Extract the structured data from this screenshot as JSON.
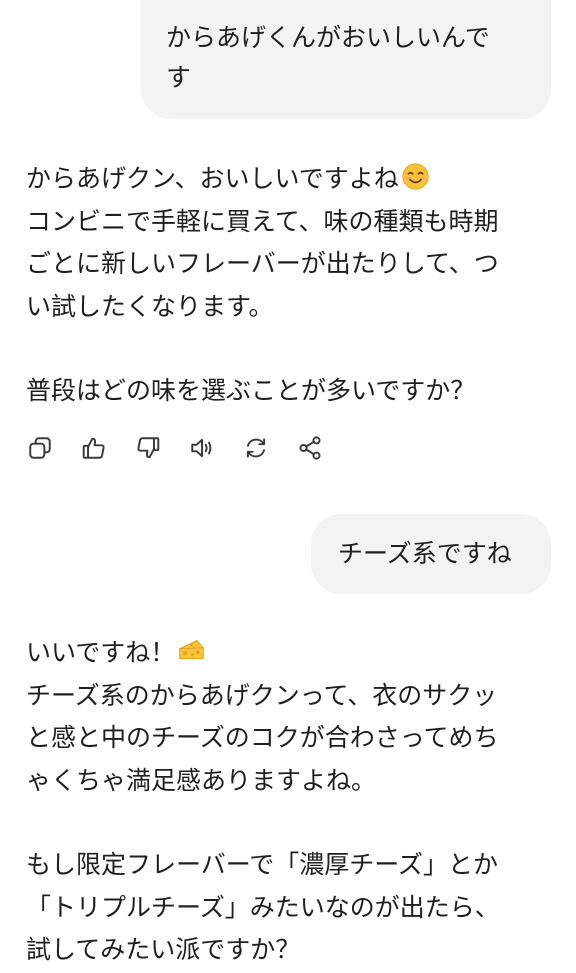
{
  "conversation": {
    "user_message_1": "からあげくんがおいしいんで\nす",
    "assistant_message_1": {
      "paragraph_1_text": "からあげクン、おいしいですよね",
      "paragraph_1_emoji": "smiling-face-emoji",
      "paragraph_1_rest": "コンビニで手軽に買えて、味の種類も時期\nごとに新しいフレーバーが出たりして、つ\nい試したくなります。",
      "paragraph_2": "普段はどの味を選ぶことが多いですか？"
    },
    "actions": [
      {
        "icon": "copy-icon"
      },
      {
        "icon": "thumbs-up-icon"
      },
      {
        "icon": "thumbs-down-icon"
      },
      {
        "icon": "speaker-icon"
      },
      {
        "icon": "regenerate-icon"
      },
      {
        "icon": "share-icon"
      }
    ],
    "user_message_2": "チーズ系ですね",
    "assistant_message_2": {
      "paragraph_1_text": "いいですね！",
      "paragraph_1_emoji": "cheese-emoji",
      "paragraph_1_rest": "チーズ系のからあげクンって、衣のサクッ\nと感と中のチーズのコクが合わさってめち\nゃくちゃ満足感ありますよね。",
      "paragraph_2": "もし限定フレーバーで「濃厚チーズ」とか\n「トリプルチーズ」みたいなのが出たら、\n試してみたい派ですか？"
    }
  },
  "colors": {
    "user_bubble_bg": "#f3f3f3",
    "text": "#1f1f1f",
    "icon_stroke": "#3a3a3a",
    "background": "#ffffff"
  }
}
